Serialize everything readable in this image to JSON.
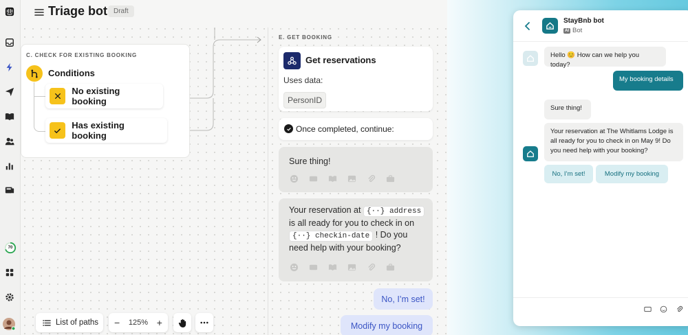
{
  "header": {
    "title": "Triage bot",
    "badge": "Draft"
  },
  "rail": {
    "progress_value": "70"
  },
  "nodes": {
    "c": {
      "label": "C. CHECK FOR EXISTING BOOKING",
      "conditions": "Conditions",
      "branches": [
        "No existing booking",
        "Has existing booking"
      ]
    },
    "e": {
      "label": "E. GET BOOKING",
      "action_title": "Get reservations",
      "uses_data": "Uses data:",
      "data_chip": "PersonID",
      "once_completed": "Once completed, continue:",
      "message1": "Sure thing!",
      "message2": {
        "part1": "Your reservation at",
        "var1": "address",
        "part2": "is all ready for you to check in on",
        "var2": "checkin-date",
        "part3": "! Do you need help with your booking?"
      },
      "replies": [
        "No, I’m set!",
        "Modify my booking"
      ]
    }
  },
  "toolbar": {
    "list_label": "List of paths",
    "zoom": "125%",
    "minus": "−",
    "plus": "+"
  },
  "chat": {
    "bot_name": "StayBnb bot",
    "ai_tag": "AI",
    "bot_sub": "Bot",
    "messages": [
      {
        "from": "bot",
        "text": "Hello 😊 How can we help you today?"
      },
      {
        "from": "user",
        "text": "My booking details"
      },
      {
        "from": "bot",
        "text": "Sure thing!"
      },
      {
        "from": "bot",
        "text": "Your reservation at The Whitlams Lodge is all ready for you to check in on May 9! Do you need help with your booking?"
      }
    ],
    "quick_replies": [
      "No, I’m set!",
      "Modify my booking"
    ]
  },
  "colors": {
    "accent_yellow": "#f6c21b",
    "bot_teal": "#177c8c",
    "reply_blue": "#3b55c4",
    "webhook_navy": "#1c2a6b"
  }
}
